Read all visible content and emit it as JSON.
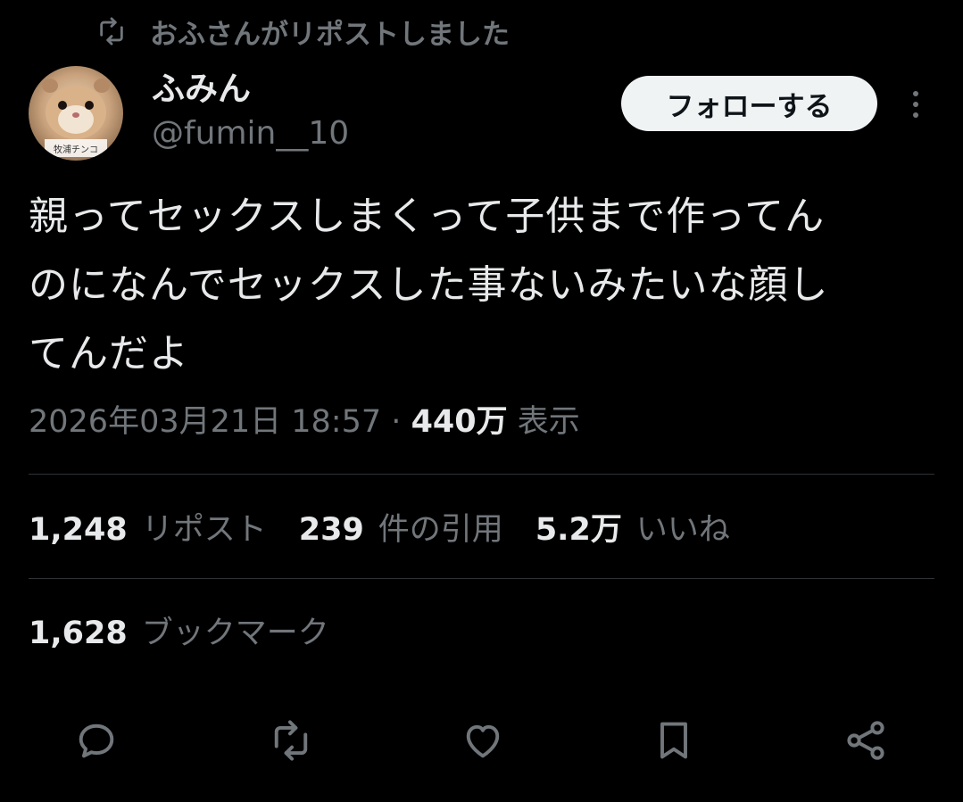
{
  "repost_context": {
    "icon": "repost-icon",
    "text": "おふさんがリポストしました"
  },
  "author": {
    "display_name": "ふみん",
    "handle": "@fumin__10",
    "avatar_caption": "牧浦チンコ"
  },
  "follow_button": {
    "label": "フォローする"
  },
  "more_button": {
    "icon": "more-vertical-icon"
  },
  "tweet": {
    "text": "親ってセックスしまくって子供まで作ってん\nのになんでセックスした事ないみたいな顔し\nてんだよ",
    "timestamp": "2026年03月21日 18:57",
    "separator": "·",
    "views_count": "440万",
    "views_label": "表示"
  },
  "stats": {
    "reposts_count": "1,248",
    "reposts_label": "リポスト",
    "quotes_count": "239",
    "quotes_label": "件の引用",
    "likes_count": "5.2万",
    "likes_label": "いいね",
    "bookmarks_count": "1,628",
    "bookmarks_label": "ブックマーク"
  },
  "actions": [
    {
      "icon": "reply-icon"
    },
    {
      "icon": "repost-icon"
    },
    {
      "icon": "like-icon"
    },
    {
      "icon": "bookmark-icon"
    },
    {
      "icon": "share-icon"
    }
  ],
  "colors": {
    "background": "#000000",
    "primary_text": "#e7e9ea",
    "secondary_text": "#71767b",
    "divider": "#2f3336",
    "follow_button_bg": "#eff3f4"
  }
}
